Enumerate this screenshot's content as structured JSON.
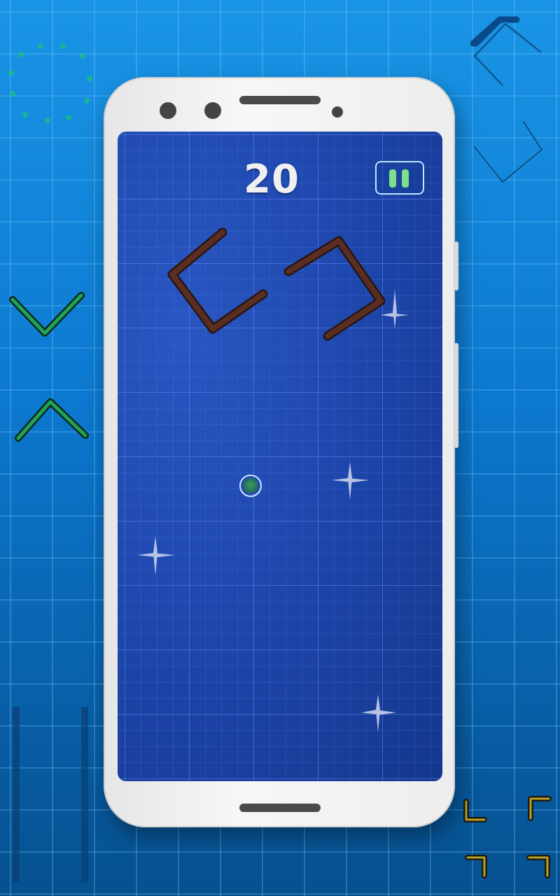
{
  "game": {
    "score": "20",
    "pause_icon": "pause-icon"
  },
  "colors": {
    "background": "#0c78cf",
    "screen": "#1e48ae",
    "obstacle": "#5a2e23",
    "ball": "#3aa05a",
    "pause": "#7ee08a",
    "decor_green": "#1fa35a",
    "decor_yellow": "#b8a11a"
  }
}
